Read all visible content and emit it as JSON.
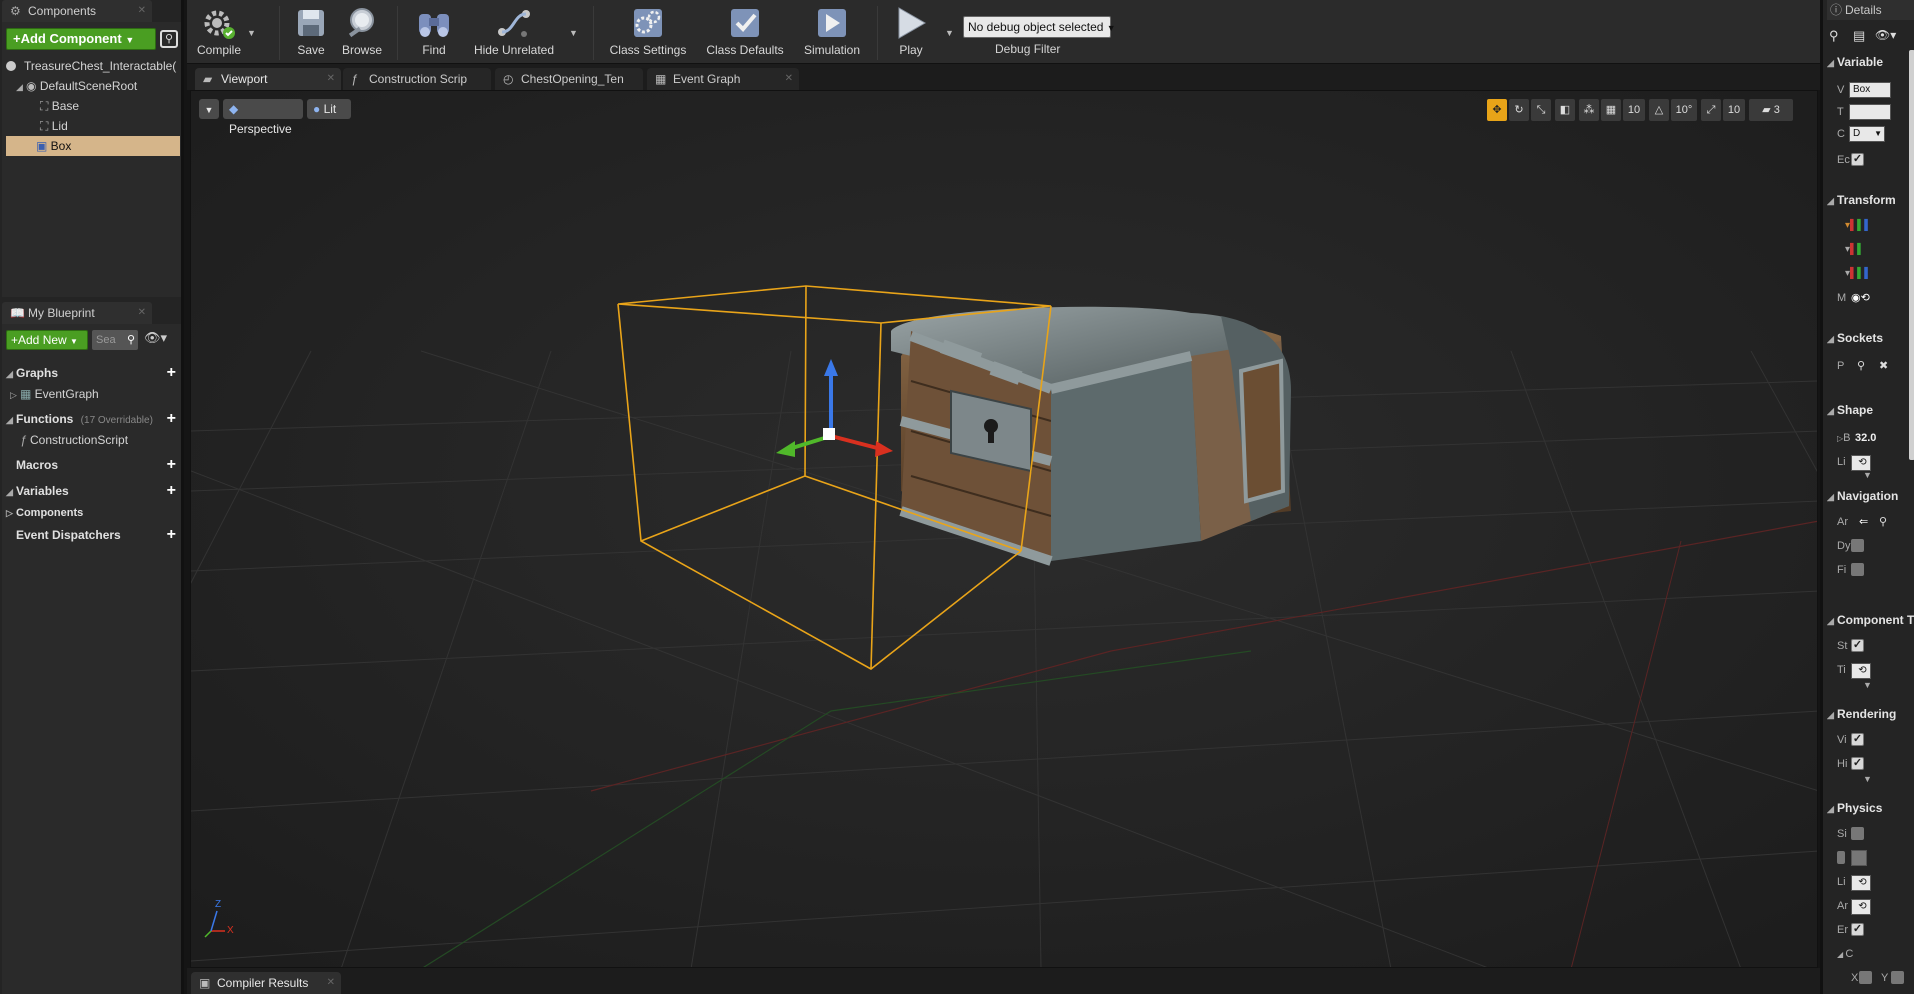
{
  "components_panel": {
    "title": "Components",
    "add_component_label": "+Add Component",
    "root_item": "TreasureChest_Interactable(",
    "tree": [
      {
        "label": "DefaultSceneRoot",
        "selected": false
      },
      {
        "label": "Base",
        "selected": false
      },
      {
        "label": "Lid",
        "selected": false
      },
      {
        "label": "Box",
        "selected": true
      }
    ]
  },
  "my_blueprint": {
    "title": "My Blueprint",
    "add_new_label": "+Add New",
    "search_placeholder": "Sea",
    "categories": {
      "graphs": "Graphs",
      "event_graph": "EventGraph",
      "functions": "Functions",
      "functions_note": "(17 Overridable)",
      "construction_script": "ConstructionScript",
      "macros": "Macros",
      "variables": "Variables",
      "components": "Components",
      "event_dispatchers": "Event Dispatchers"
    }
  },
  "toolbar": {
    "compile": "Compile",
    "save": "Save",
    "browse": "Browse",
    "find": "Find",
    "hide_unrelated": "Hide Unrelated",
    "class_settings": "Class Settings",
    "class_defaults": "Class Defaults",
    "simulation": "Simulation",
    "play": "Play",
    "debug_selector": "No debug object selected",
    "debug_filter": "Debug Filter"
  },
  "tabs": [
    {
      "label": "Viewport",
      "active": true
    },
    {
      "label": "Construction Scrip",
      "active": false
    },
    {
      "label": "ChestOpening_Ten",
      "active": false
    },
    {
      "label": "Event Graph",
      "active": false
    }
  ],
  "viewport": {
    "perspective_label": "Perspective",
    "lit_label": "Lit",
    "grid_snap": "10",
    "rotation_snap": "10°",
    "scale_snap": "10",
    "camera_speed": "3",
    "axis_x": "X",
    "axis_z": "Z"
  },
  "bottom": {
    "compiler_results": "Compiler Results"
  },
  "details": {
    "title": "Details",
    "sections": {
      "variable": "Variable",
      "transform": "Transform",
      "sockets": "Sockets",
      "shape": "Shape",
      "navigation": "Navigation",
      "component_tick": "Component T",
      "rendering": "Rendering",
      "physics": "Physics"
    },
    "variable_rows": {
      "v": "V",
      "v_value": "Box",
      "t": "T",
      "c": "C",
      "c_value": "D",
      "e": "Ec"
    },
    "transform_rows": {
      "m": "M"
    },
    "sockets_rows": {
      "p": "P"
    },
    "shape_rows": {
      "b": "B",
      "b_value": "32.0",
      "li": "Li"
    },
    "navigation_rows": {
      "ar": "Ar",
      "dy": "Dy",
      "fi": "Fi"
    },
    "tick_rows": {
      "st": "St",
      "ti": "Ti"
    },
    "rendering_rows": {
      "vi": "Vi",
      "hi": "Hi"
    },
    "physics_rows": {
      "si": "Si",
      "li": "Li",
      "ar": "Ar",
      "er": "Er",
      "c": "C",
      "x": "X",
      "y": "Y"
    }
  },
  "colors": {
    "accent_green": "#4a9e22",
    "selection": "#d5b58a",
    "bounding_box": "#e9a419"
  }
}
